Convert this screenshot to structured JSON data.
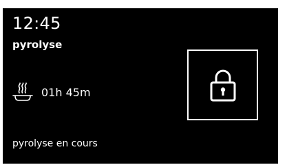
{
  "display": {
    "time": "12:45",
    "mode": "pyrolyse",
    "duration": "01h 45m",
    "status": "pyrolyse en cours"
  },
  "icons": {
    "heat": "heating-dish-icon",
    "lock": "padlock-icon"
  },
  "colors": {
    "background": "#000000",
    "foreground": "#ffffff"
  }
}
